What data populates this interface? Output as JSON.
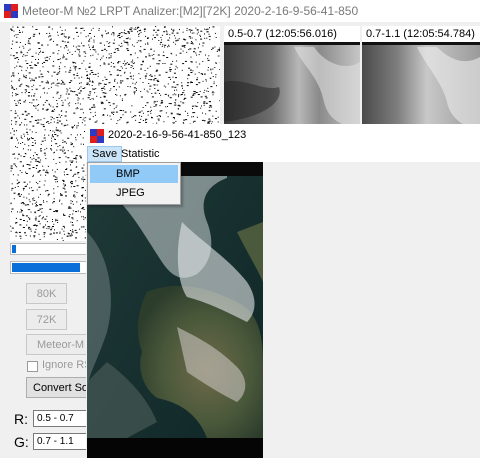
{
  "main_window": {
    "title": "Meteor-M №2 LRPT Analizer:[M2][72K] 2020-2-16-9-56-41-850",
    "channels": [
      {
        "label": "0.5-0.7 (12:05:56.016)"
      },
      {
        "label": "0.7-1.1 (12:05:54.784)"
      }
    ],
    "progress_1": 0.02,
    "progress_2": 0.33,
    "buttons": {
      "b80k": "80K",
      "b72k": "72K",
      "meteor": "Meteor-M N",
      "convert": "Convert Soft"
    },
    "ignore_rs_label": "Ignore RS",
    "rgb": {
      "r_label": "R:",
      "r_value": "0.5 - 0.7",
      "g_label": "G:",
      "g_value": "0.7 - 1.1"
    }
  },
  "image_window": {
    "title": "2020-2-16-9-56-41-850_123",
    "menu": [
      "Save",
      "Statistic"
    ],
    "dropdown": [
      "BMP",
      "JPEG"
    ]
  },
  "icons": [
    "app-icon",
    "image-window-icon",
    "checkbox-icon"
  ],
  "colors": {
    "progress": "#0a6fd8",
    "menu_highlight": "#91c9f7",
    "title_text": "#7a7a7a"
  }
}
